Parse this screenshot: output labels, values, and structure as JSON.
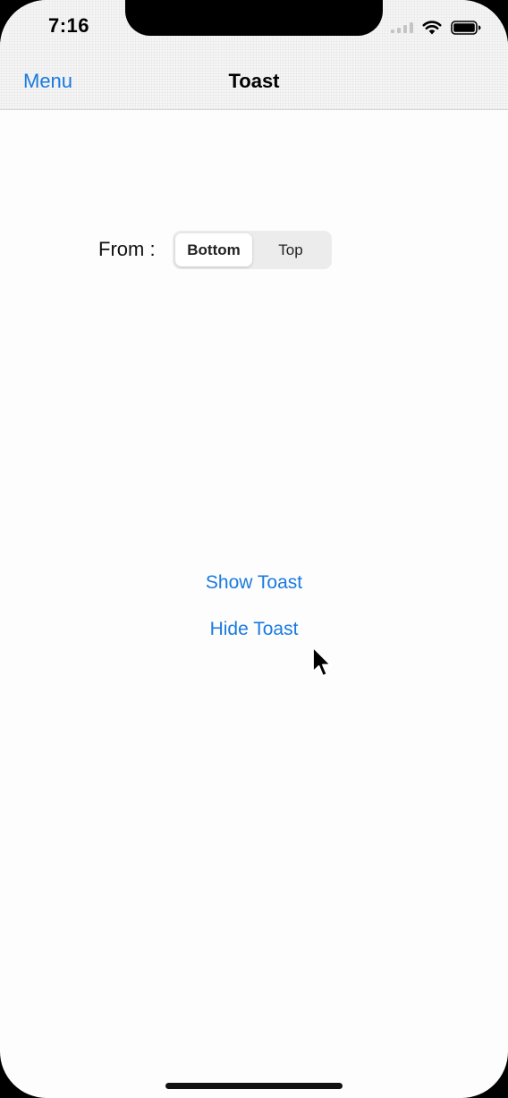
{
  "status_bar": {
    "time": "7:16",
    "icons": [
      "signal-icon",
      "wifi-icon",
      "battery-icon"
    ]
  },
  "nav": {
    "back_label": "Menu",
    "title": "Toast"
  },
  "position_control": {
    "label": "From :",
    "options": [
      "Bottom",
      "Top"
    ],
    "selected": "Bottom"
  },
  "actions": {
    "show_label": "Show Toast",
    "hide_label": "Hide Toast"
  },
  "colors": {
    "accent": "#1a7ae0",
    "background": "#fdfdfd",
    "nav_background": "#f6f6f6"
  }
}
